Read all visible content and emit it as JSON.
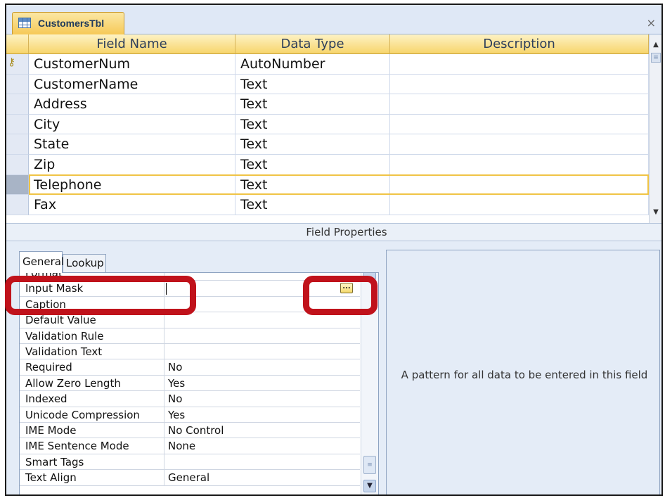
{
  "document_tab": {
    "title": "CustomersTbl",
    "icon": "table-icon",
    "close_label": "×"
  },
  "design_grid": {
    "columns": [
      "Field Name",
      "Data Type",
      "Description"
    ],
    "rows": [
      {
        "field_name": "CustomerNum",
        "data_type": "AutoNumber",
        "description": "",
        "primary_key": true
      },
      {
        "field_name": "CustomerName",
        "data_type": "Text",
        "description": ""
      },
      {
        "field_name": "Address",
        "data_type": "Text",
        "description": ""
      },
      {
        "field_name": "City",
        "data_type": "Text",
        "description": ""
      },
      {
        "field_name": "State",
        "data_type": "Text",
        "description": ""
      },
      {
        "field_name": "Zip",
        "data_type": "Text",
        "description": ""
      },
      {
        "field_name": "Telephone",
        "data_type": "Text",
        "description": "",
        "selected": true
      },
      {
        "field_name": "Fax",
        "data_type": "Text",
        "description": ""
      }
    ]
  },
  "field_properties": {
    "title": "Field Properties",
    "tabs": [
      "General",
      "Lookup"
    ],
    "active_tab": "General",
    "properties": [
      {
        "name": "Format",
        "value": ""
      },
      {
        "name": "Input Mask",
        "value": ""
      },
      {
        "name": "Caption",
        "value": ""
      },
      {
        "name": "Default Value",
        "value": ""
      },
      {
        "name": "Validation Rule",
        "value": ""
      },
      {
        "name": "Validation Text",
        "value": ""
      },
      {
        "name": "Required",
        "value": "No"
      },
      {
        "name": "Allow Zero Length",
        "value": "Yes"
      },
      {
        "name": "Indexed",
        "value": "No"
      },
      {
        "name": "Unicode Compression",
        "value": "Yes"
      },
      {
        "name": "IME Mode",
        "value": "No Control"
      },
      {
        "name": "IME Sentence Mode",
        "value": "None"
      },
      {
        "name": "Smart Tags",
        "value": ""
      },
      {
        "name": "Text Align",
        "value": "General"
      }
    ],
    "build_button_label": "...",
    "help_text": "A pattern for all data to be entered in this field"
  },
  "colors": {
    "highlight_red": "#c0121b",
    "selected_row": "#f0c445",
    "header_gold": "#f7d56c"
  }
}
